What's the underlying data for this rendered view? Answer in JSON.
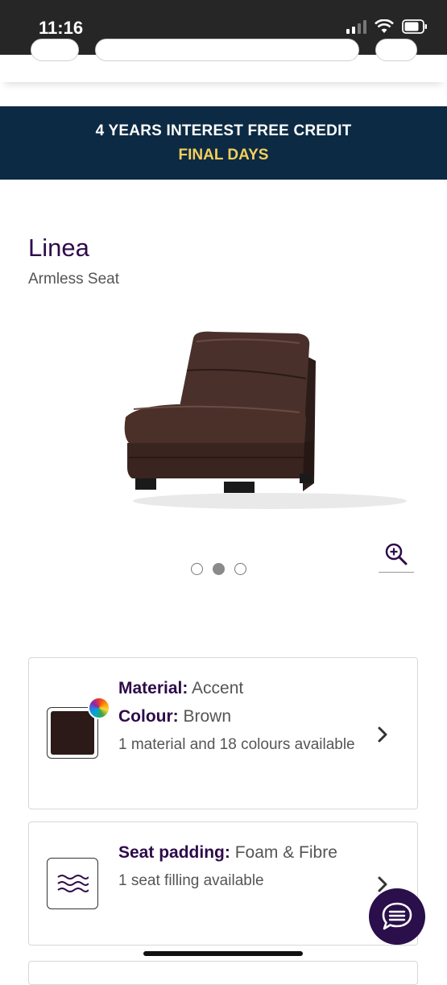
{
  "status_bar": {
    "time": "11:16"
  },
  "banner": {
    "line1": "4 YEARS INTEREST FREE CREDIT",
    "line2": "FINAL DAYS",
    "bg_color": "#0c2a43",
    "accent_color": "#f3cf5c"
  },
  "product": {
    "title": "Linea",
    "subtitle": "Armless Seat",
    "image": "brown-leather-armless-seat",
    "carousel": {
      "total": 3,
      "active_index": 1
    }
  },
  "options": [
    {
      "label1": "Material:",
      "value1": "Accent",
      "label2": "Colour:",
      "value2": "Brown",
      "detail": "1 material and 18 colours available",
      "swatch_color": "#2b1a17",
      "icon": "colour-swatch"
    },
    {
      "label1": "Seat padding:",
      "value1": "Foam & Fibre",
      "detail": "1 seat filling available",
      "icon": "waves-icon"
    }
  ],
  "icons": {
    "zoom": "zoom-in-icon",
    "chevron": "chevron-right-icon",
    "chat": "chat-icon"
  },
  "colors": {
    "brand": "#2e0b4a",
    "chat_fab": "#2a0f4a"
  }
}
